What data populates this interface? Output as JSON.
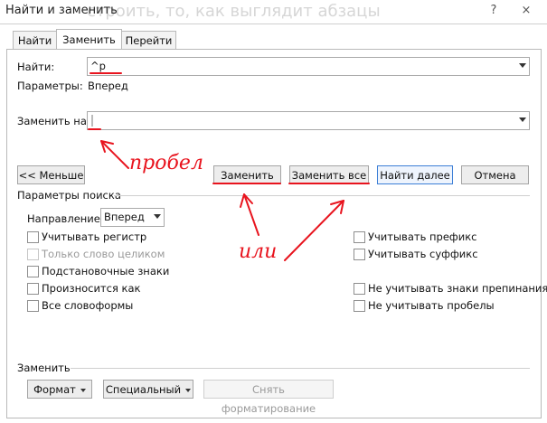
{
  "window": {
    "title": "Найти и заменить",
    "background_text": "строить, то, как выглядит абзацы",
    "help_symbol": "?",
    "close_symbol": "×"
  },
  "tabs": [
    {
      "label": "Найти",
      "active": false
    },
    {
      "label": "Заменить",
      "active": true
    },
    {
      "label": "Перейти",
      "active": false
    }
  ],
  "find": {
    "label": "Найти:",
    "value": "^p",
    "params_label": "Параметры:",
    "params_value": "Вперед"
  },
  "replace": {
    "label": "Заменить на:",
    "value": ""
  },
  "buttons": {
    "less": "<< Меньше",
    "replace": "Заменить",
    "replace_all": "Заменить все",
    "find_next": "Найти далее",
    "cancel": "Отмена"
  },
  "search_options": {
    "heading": "Параметры поиска",
    "direction_label": "Направление:",
    "direction_value": "Вперед",
    "left": [
      {
        "label": "Учитывать регистр",
        "enabled": true
      },
      {
        "label": "Только слово целиком",
        "enabled": false
      },
      {
        "label": "Подстановочные знаки",
        "enabled": true
      },
      {
        "label": "Произносится как",
        "enabled": true
      },
      {
        "label": "Все словоформы",
        "enabled": true
      }
    ],
    "right": [
      {
        "label": "Учитывать префикс",
        "enabled": true
      },
      {
        "label": "Учитывать суффикс",
        "enabled": true
      },
      {
        "label": "Не учитывать знаки препинания",
        "enabled": true
      },
      {
        "label": "Не учитывать пробелы",
        "enabled": true
      }
    ]
  },
  "replace_section": {
    "heading": "Заменить",
    "format_button": "Формат",
    "special_button": "Специальный",
    "clear_format_button": "Снять форматирование"
  },
  "annotations": {
    "space_note": "пробел",
    "or_note": "или",
    "color": "#e8141e"
  }
}
